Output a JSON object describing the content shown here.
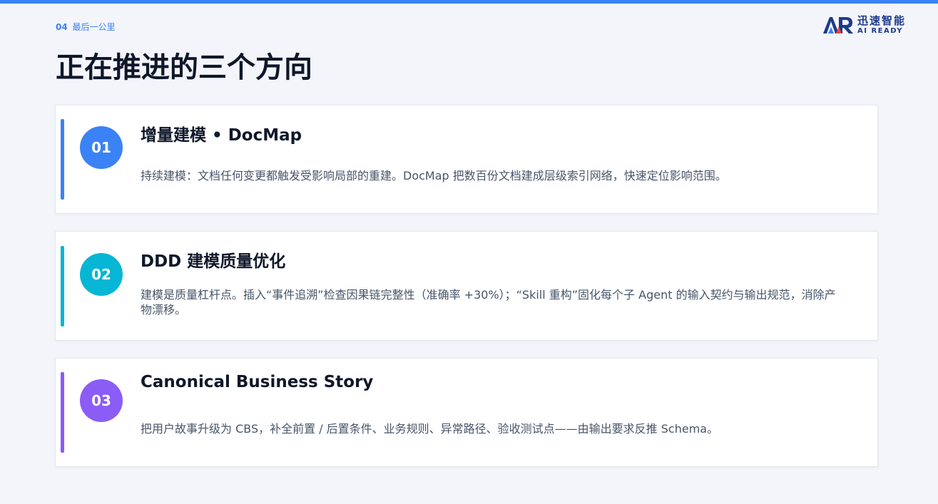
{
  "header": {
    "section_number": "04",
    "section_name": "最后一公里",
    "title": "正在推进的三个方向"
  },
  "logo": {
    "brand_cn": "迅速智能",
    "brand_en": "AI READY",
    "mark": "AR",
    "colors": {
      "primary": "#1e3a8a",
      "accent": "#3b82f6"
    }
  },
  "cards": [
    {
      "number": "01",
      "title": "增量建模 • DocMap",
      "description": "持续建模：文档任何变更都触发受影响局部的重建。DocMap 把数百份文档建成层级索引网络，快速定位影响范围。",
      "color": "#3b82f6"
    },
    {
      "number": "02",
      "title": "DDD 建模质量优化",
      "description": "建模是质量杠杆点。插入“事件追溯”检查因果链完整性（准确率 +30%）；“Skill 重构”固化每个子 Agent 的输入契约与输出规范，消除产物漂移。",
      "color": "#06b6d4"
    },
    {
      "number": "03",
      "title": "Canonical Business Story",
      "description": "把用户故事升级为 CBS，补全前置 / 后置条件、业务规则、异常路径、验收测试点——由输出要求反推 Schema。",
      "color": "#8b5cf6"
    }
  ],
  "theme": {
    "top_bar": "#3b82f6",
    "title_color": "#0f172a",
    "text_color": "#475569"
  }
}
